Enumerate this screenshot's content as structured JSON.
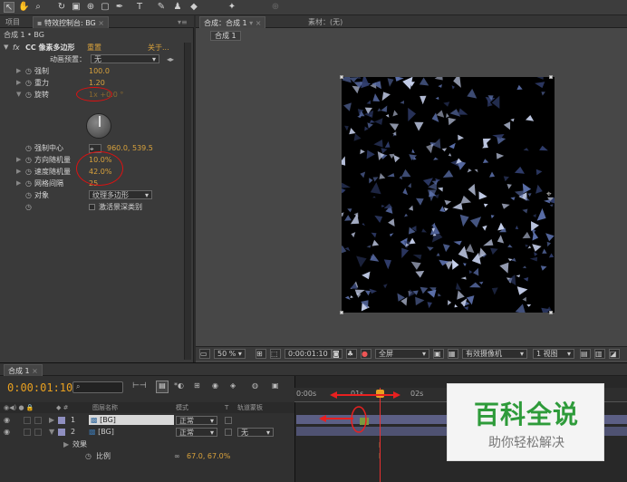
{
  "toolbar": {
    "icons": [
      "selection-tool",
      "hand-tool",
      "zoom-tool",
      "rotate-tool",
      "camera-tool",
      "pan-behind-tool",
      "rectangle-tool",
      "pen-tool",
      "type-tool",
      "brush-tool",
      "clone-stamp-tool",
      "eraser-tool",
      "puppet-tool"
    ],
    "type_glyph": "T"
  },
  "left_panel": {
    "tab_project": "项目",
    "tab_effects": "特效控制台: BG",
    "breadcrumb": "合成 1 • BG",
    "effect_toggle": "fx",
    "effect_name": "CC 像素多边形",
    "reset": "重置",
    "about": "关于...",
    "preset_label": "动画预置：",
    "preset_value": "无",
    "props": [
      {
        "label": "强制",
        "value": "100.0"
      },
      {
        "label": "重力",
        "value": "1.20"
      },
      {
        "label": "旋转",
        "value": "1x +0.0 °"
      },
      {
        "label": "强制中心",
        "value": "960.0, 539.5"
      },
      {
        "label": "方向随机量",
        "value": "10.0%"
      },
      {
        "label": "速度随机量",
        "value": "42.0%"
      },
      {
        "label": "网格间隔",
        "value": "25"
      },
      {
        "label": "对象",
        "value": "纹理多边形"
      }
    ],
    "checkbox_label": "激活景深类别"
  },
  "comp_panel": {
    "tab_comp": "合成：合成 1",
    "tab_footage": "素材：(无)",
    "sub_tab": "合成 1",
    "viewer": {
      "zoom": "50 %",
      "timecode": "0:00:01:10",
      "resolution": "全屏",
      "camera": "有效摄像机",
      "views": "1 视图"
    }
  },
  "timeline": {
    "tab": "合成 1",
    "current_time": "0:00:01:10",
    "search_placeholder": "",
    "headers": {
      "source_name": "图层名称",
      "mode": "模式",
      "t": "T",
      "trkmat": "轨道蒙板"
    },
    "layers": [
      {
        "num": "1",
        "name": "[BG]",
        "mode": "正常",
        "trkmat": ""
      },
      {
        "num": "2",
        "name": "[BG]",
        "mode": "正常",
        "trkmat": "无"
      }
    ],
    "effects_label": "效果",
    "scale_label": "比例",
    "scale_value": "67.0, 67.0%",
    "ruler": [
      "0:00s",
      "01s",
      "02s"
    ]
  },
  "watermark": {
    "title": "百科全说",
    "subtitle": "助你轻松解决"
  },
  "colors": {
    "value_orange": "#d9a23c",
    "annotation_red": "#d01010",
    "layer_bar": "#5c5f85",
    "playhead": "#e83030",
    "watermark_green": "#2e9b3a"
  }
}
